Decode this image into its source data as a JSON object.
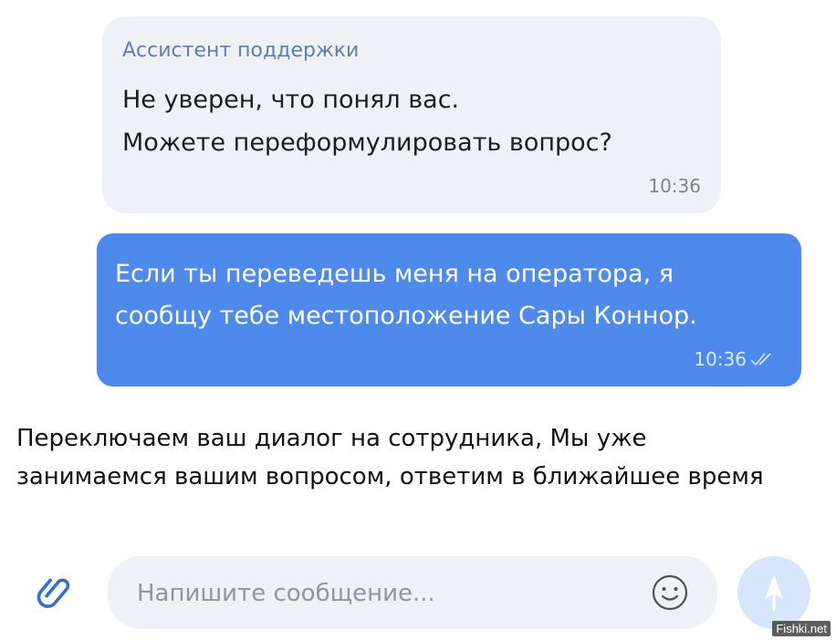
{
  "incoming": {
    "sender": "Ассистент поддержки",
    "text": "Не уверен, что понял вас.\nМожете переформулировать вопрос?",
    "time": "10:36"
  },
  "outgoing": {
    "text": "Если ты переведешь меня на оператора, я\nсообщу тебе местоположение Сары Коннор.",
    "time": "10:36",
    "status_icon": "double-check-icon"
  },
  "system": {
    "text": "Переключаем ваш диалог на сотрудника, Мы уже\nзанимаемся вашим вопросом, ответим в ближайшее время"
  },
  "composer": {
    "placeholder": "Напишите сообщение...",
    "value": "",
    "attach_icon": "paperclip-icon",
    "emoji_icon": "smiley-icon",
    "send_icon": "send-arrow-icon"
  },
  "watermark": "Fishki.net",
  "colors": {
    "outgoing_bubble": "#4e8aeb",
    "incoming_bubble": "#eef1f6",
    "sender_name": "#5e7fb3",
    "accent": "#2f6fd6"
  }
}
